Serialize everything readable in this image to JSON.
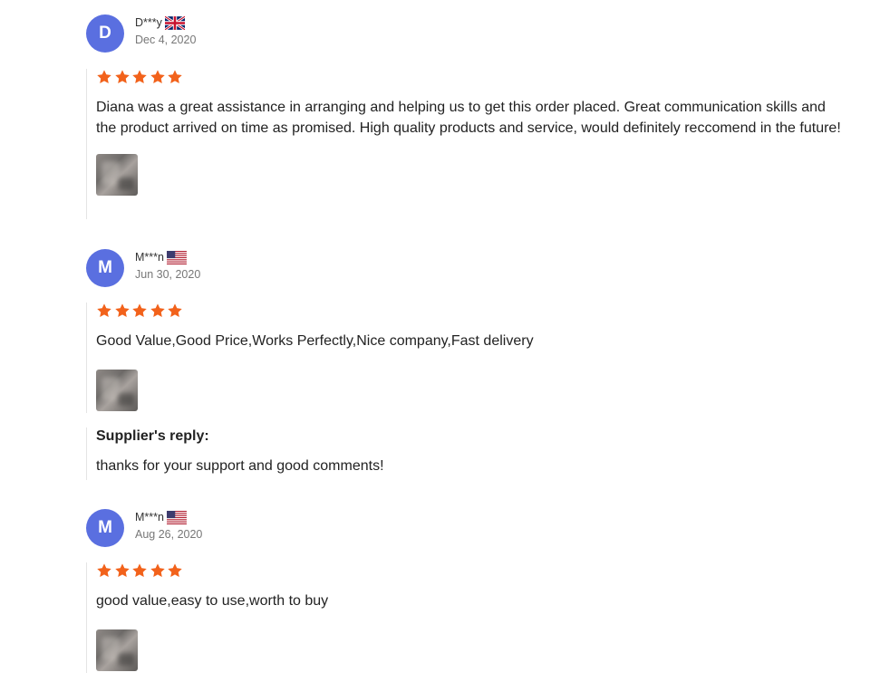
{
  "colors": {
    "avatar": "#5a6fe0",
    "star": "#f2621b",
    "divider": "#e4e4e4"
  },
  "reviews": [
    {
      "avatar_letter": "D",
      "name": "D***y",
      "flag": "uk-flag-icon",
      "date": "Dec 4, 2020",
      "rating": 5,
      "text": "Diana was a great assistance in arranging and helping us to get this order placed. Great communication skills and the product arrived on time as promised. High quality products and service, would definitely reccomend in the future!"
    },
    {
      "avatar_letter": "M",
      "name": "M***n",
      "flag": "us-flag-icon",
      "date": "Jun 30, 2020",
      "rating": 5,
      "text": "Good Value,Good Price,Works Perfectly,Nice company,Fast delivery",
      "supplier_reply": {
        "title": "Supplier's reply:",
        "text": "thanks for your support and good comments!"
      }
    },
    {
      "avatar_letter": "M",
      "name": "M***n",
      "flag": "us-flag-icon",
      "date": "Aug 26, 2020",
      "rating": 5,
      "text": "good value,easy to use,worth to buy"
    }
  ]
}
